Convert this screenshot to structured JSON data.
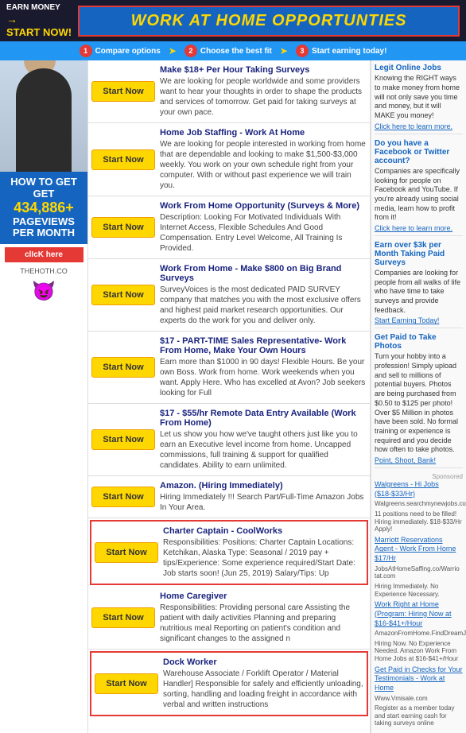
{
  "header": {
    "earn_label": "EARN MONEY",
    "start_label": "START NOW!",
    "arrow": "→",
    "main_title": "WORK AT HOME OPPORTUNTIES"
  },
  "steps": {
    "step1_num": "1",
    "step1_label": "Compare options",
    "step2_num": "2",
    "step2_label": "Choose the best fit",
    "step3_num": "3",
    "step3_label": "Start earning today!"
  },
  "left_ad": {
    "how_to": "HOW TO GET",
    "pageviews": "434,886+",
    "pageviews_label": "PAGEVIEWS",
    "per_month": "PER MONTH",
    "click_here": "clIcK here",
    "thehoth": "THEHOTH.CO",
    "devil": "😈"
  },
  "listings": [
    {
      "id": 1,
      "button_label": "Start Now",
      "title": "Make $18+ Per Hour Taking Surveys",
      "desc": "We are looking for people worldwide and some providers want to hear your thoughts in order to shape the products and services of tomorrow. Get paid for taking surveys at your own pace.",
      "highlighted": false
    },
    {
      "id": 2,
      "button_label": "Start Now",
      "title": "Home Job Staffing - Work At Home",
      "desc": "We are looking for people interested in working from home that are dependable and looking to make $1,500-$3,000 weekly. You work on your own schedule right from your computer. With or without past experience we will train you.",
      "highlighted": false
    },
    {
      "id": 3,
      "button_label": "Start Now",
      "title": "Work From Home Opportunity (Surveys & More)",
      "desc": "Description: Looking For Motivated Individuals With Internet Access, Flexible Schedules And Good Compensation. Entry Level Welcome, All Training Is Provided.",
      "highlighted": false
    },
    {
      "id": 4,
      "button_label": "Start Now",
      "title": "Work From Home - Make $800 on Big Brand Surveys",
      "desc": "SurveyVoices is the most dedicated PAID SURVEY company that matches you with the most exclusive offers and highest paid market research opportunities. Our experts do the work for you and deliver only.",
      "highlighted": false
    },
    {
      "id": 5,
      "button_label": "Start Now",
      "title": "$17 - PART-TIME Sales Representative- Work From Home, Make Your Own Hours",
      "desc": "Earn more than $1000 in 90 days! Flexible Hours. Be your own Boss. Work from home. Work weekends when you want. Apply Here. Who has excelled at Avon? Job seekers looking for Full",
      "highlighted": false
    },
    {
      "id": 6,
      "button_label": "Start Now",
      "title": "$17 - $55/hr Remote Data Entry Available (Work From Home)",
      "desc": "Let us show you how we've taught others just like you to earn an Executive level income from home. Uncapped commissions, full training & support for qualified candidates. Ability to earn unlimited.",
      "highlighted": false
    },
    {
      "id": 7,
      "button_label": "Start Now",
      "title": "Amazon. (Hiring Immediately)",
      "desc": "Hiring Immediately !!! Search Part/Full-Time Amazon Jobs In Your Area.",
      "highlighted": false
    },
    {
      "id": 8,
      "button_label": "Start Now",
      "title": "Charter Captain - CoolWorks",
      "desc": "Responsibilities: Positions: Charter Captain Locations: Ketchikan, Alaska Type: Seasonal / 2019 pay + tips/Experience: Some experience required/Start Date: Job starts soon! (Jun 25, 2019) Salary/Tips: Up",
      "highlighted": true
    },
    {
      "id": 9,
      "button_label": "Start Now",
      "title": "Home Caregiver",
      "desc": "Responsibilities: Providing personal care Assisting the patient with daily activities Planning and preparing nutritious meal Reporting on patient's condition and significant changes to the assigned n",
      "highlighted": false
    },
    {
      "id": 10,
      "button_label": "Start Now",
      "title": "Dock Worker",
      "desc": "Warehouse Associate / Forklift Operator / Material Handler] Responsible for safely and efficiently unloading, sorting, handling and loading freight in accordance with verbal and written instructions",
      "highlighted": true
    }
  ],
  "right_sidebar": {
    "sections": [
      {
        "id": "legit-online-jobs",
        "title": "Legit Online Jobs",
        "text": "Knowing the RIGHT ways to make money from home will not only save you time and money, but it will MAKE you money!",
        "link": "Click here to learn more."
      },
      {
        "id": "facebook-twitter",
        "title": "Do you have a Facebook or Twitter account?",
        "text": "Companies are specifically looking for people on Facebook and YouTube. If you're already using social media, learn how to profit from it!",
        "link": "Click here to learn more."
      },
      {
        "id": "earn-35k",
        "title": "Earn over $3k per Month Taking Paid Surveys",
        "text": "Companies are looking for people from all walks of life who have time to take surveys and provide feedback.",
        "link": "Start Earning Today!"
      },
      {
        "id": "paid-photos",
        "title": "Get Paid to Take Photos",
        "text": "Turn your hobby into a profession! Simply upload and sell to millions of potential buyers. Photos are being purchased from $0.50 to $125 per photo! Over $5 Million in photos have been sold. No formal training or experience is required and you decide how often to take photos.",
        "link": "Point, Shoot, Bank!"
      }
    ],
    "sponsored_label": "Sponsored",
    "jobs": [
      {
        "link": "Walgreens - Hi Jobs ($18-$33/Hr)",
        "url": "Walgreens.searchmynewjobs.co",
        "desc": "11 positions need to be filled! Hiring immediately. $18-$33/Hr Apply!"
      },
      {
        "link": "Marriott Reservations Agent - Work From Home $17/Hr",
        "url": "JobsAtHomeSaffing.co/Warrio tat.com",
        "desc": "Hiring Immediately. No Experience Necessary."
      },
      {
        "link": "Work Right at Home (Program: Hiring Now at $16-$41+/Hour",
        "url": "AmazonFromHome.FindDreamJobs.com",
        "desc": "Hiring Now. No Experience Needed. Amazon Work From Home Jobs at $16-$41+/Hour"
      },
      {
        "link": "Get Paid in Checks for Your Testimonials - Work at Home",
        "url": "Www.Vmisale.com",
        "desc": "Register as a member today and start earning cash for taking surveys online"
      }
    ]
  }
}
